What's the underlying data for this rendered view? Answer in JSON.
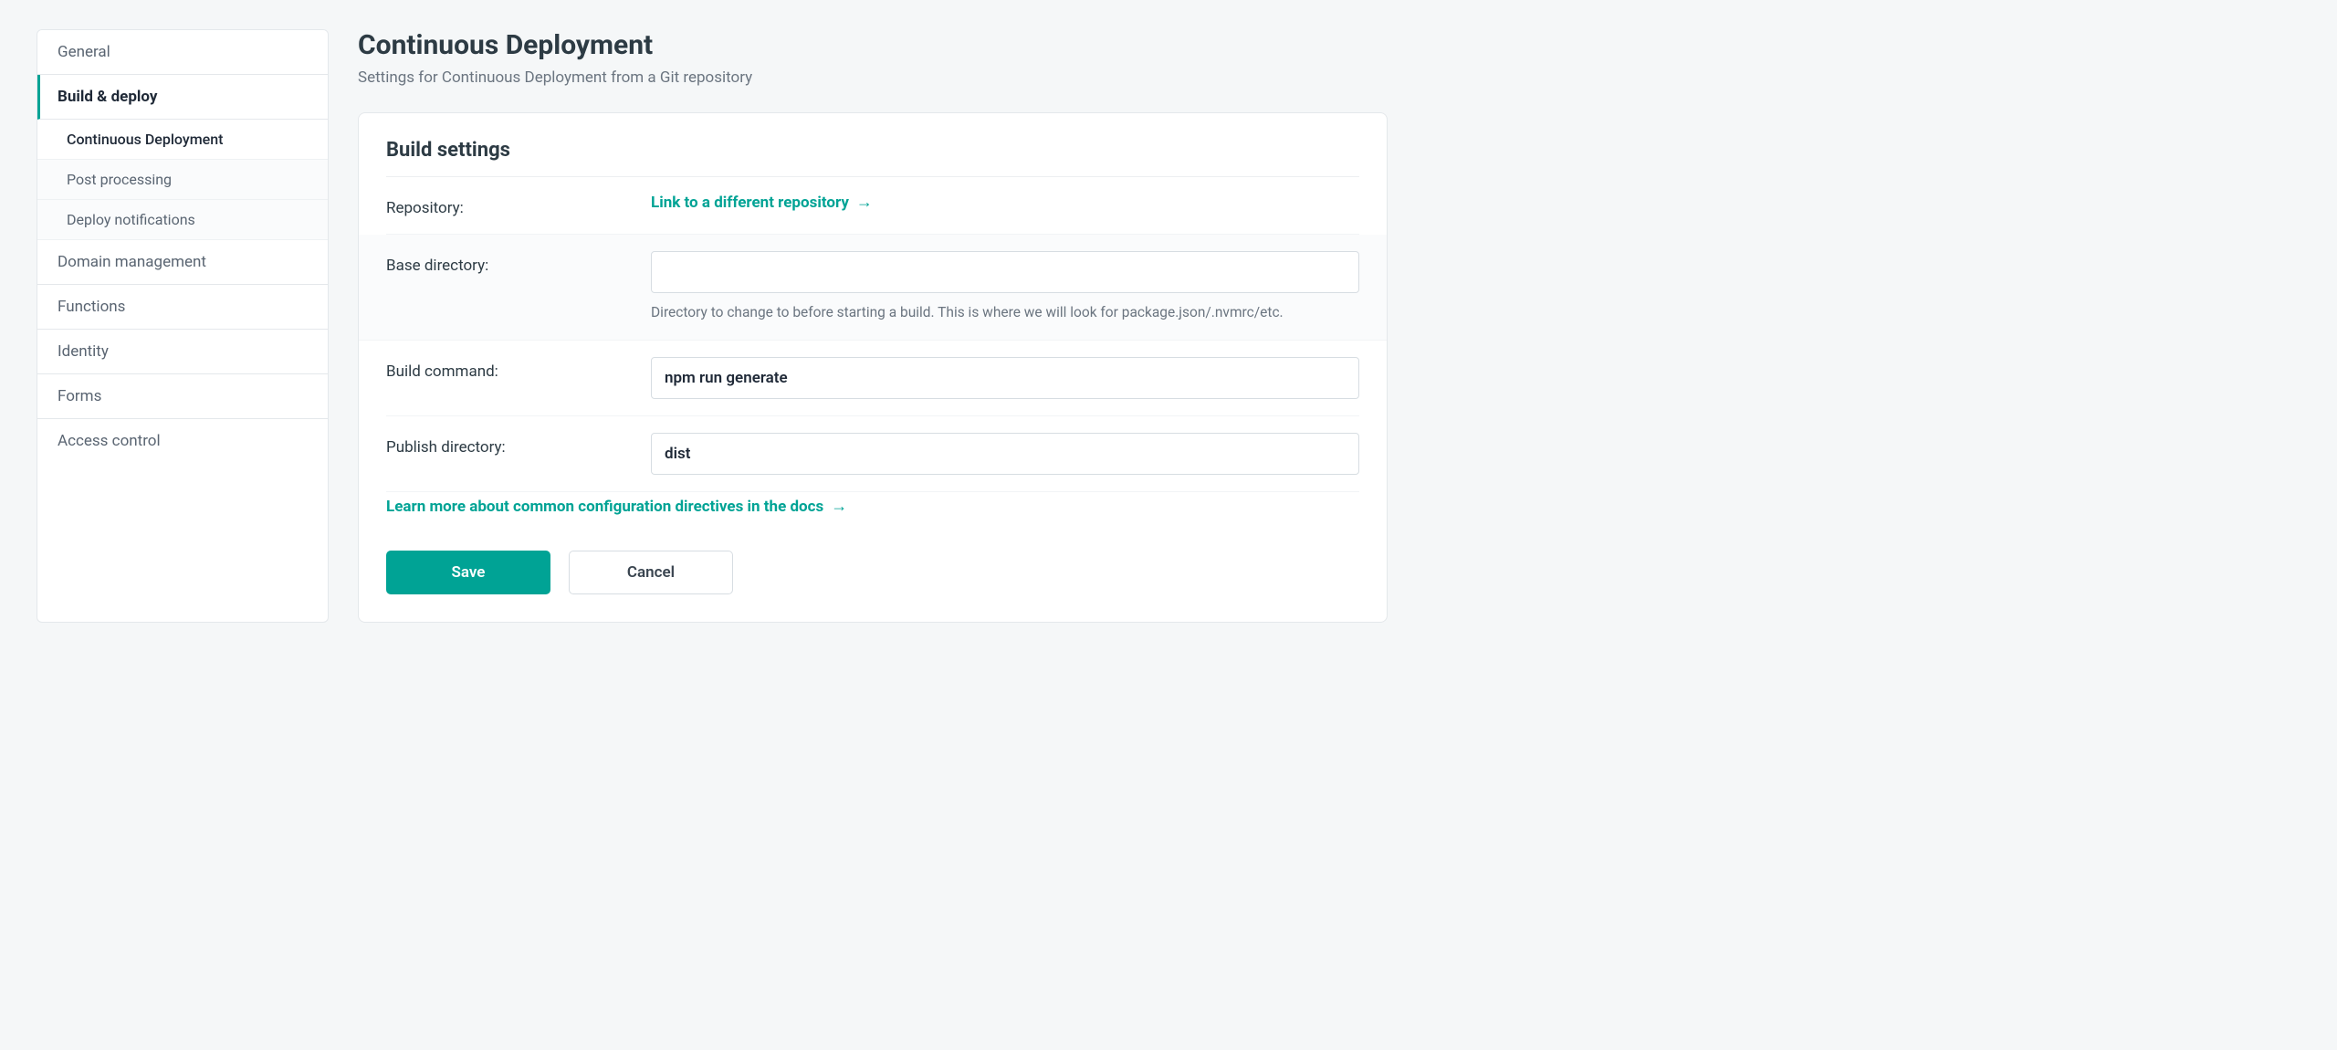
{
  "sidebar": {
    "items": [
      {
        "label": "General",
        "active": false
      },
      {
        "label": "Build & deploy",
        "active": true,
        "subitems": [
          {
            "label": "Continuous Deployment",
            "active": true
          },
          {
            "label": "Post processing",
            "active": false
          },
          {
            "label": "Deploy notifications",
            "active": false
          }
        ]
      },
      {
        "label": "Domain management",
        "active": false
      },
      {
        "label": "Functions",
        "active": false
      },
      {
        "label": "Identity",
        "active": false
      },
      {
        "label": "Forms",
        "active": false
      },
      {
        "label": "Access control",
        "active": false
      }
    ]
  },
  "header": {
    "title": "Continuous Deployment",
    "subtitle": "Settings for Continuous Deployment from a Git repository"
  },
  "card": {
    "title": "Build settings",
    "rows": {
      "repository": {
        "label": "Repository:",
        "link_text": "Link to a different repository"
      },
      "base_directory": {
        "label": "Base directory:",
        "value": "",
        "help": "Directory to change to before starting a build. This is where we will look for package.json/.nvmrc/etc."
      },
      "build_command": {
        "label": "Build command:",
        "value": "npm run generate"
      },
      "publish_directory": {
        "label": "Publish directory:",
        "value": "dist"
      }
    },
    "docs_link": "Learn more about common configuration directives in the docs",
    "buttons": {
      "save": "Save",
      "cancel": "Cancel"
    }
  },
  "colors": {
    "accent": "#00a395",
    "text": "#2d3b44",
    "muted": "#6b7580",
    "border": "#e4e8eb",
    "bg": "#f5f7f8"
  }
}
